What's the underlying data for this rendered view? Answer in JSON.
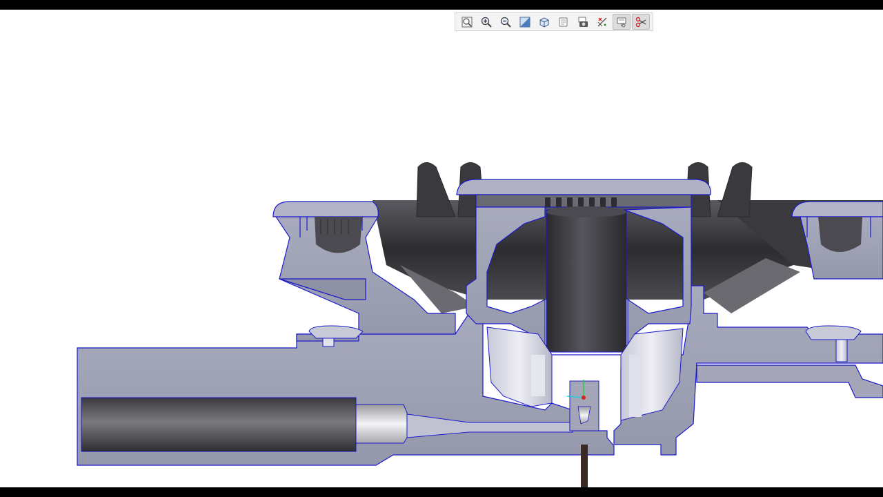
{
  "app": {
    "background_color": "#ffffff",
    "letterbox_color": "#000000"
  },
  "toolbar": {
    "buttons": [
      {
        "name": "zoom-fit",
        "icon": "zoom-fit-icon",
        "active": false
      },
      {
        "name": "zoom-in",
        "icon": "zoom-in-icon",
        "active": false
      },
      {
        "name": "zoom-out",
        "icon": "zoom-out-icon",
        "active": false
      },
      {
        "name": "view-orientation",
        "icon": "view-orientation-icon",
        "active": false
      },
      {
        "name": "display-style",
        "icon": "display-style-icon",
        "active": false
      },
      {
        "name": "saved-views",
        "icon": "saved-views-icon",
        "active": false
      },
      {
        "name": "snapshot",
        "icon": "camera-icon",
        "active": false
      },
      {
        "name": "datum-display",
        "icon": "datum-display-icon",
        "active": false
      },
      {
        "name": "annotation-display",
        "icon": "annotation-display-icon",
        "active": true
      },
      {
        "name": "section-view",
        "icon": "section-scissors-icon",
        "active": true
      }
    ]
  },
  "model": {
    "section_fill": "#9ea0b4",
    "dark_surface": "#3c3c40",
    "edge_color": "#1a1acc",
    "highlight_color": "#d8d8e4"
  }
}
